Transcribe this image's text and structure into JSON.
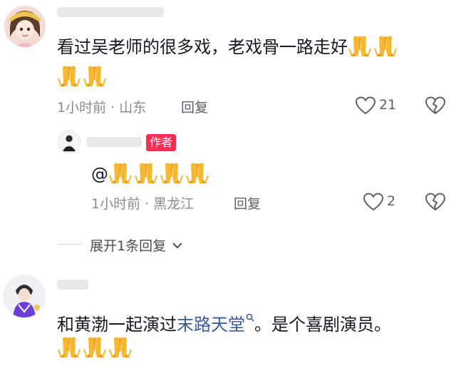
{
  "comments": [
    {
      "text": "看过吴老师的很多戏，老戏骨一路走好",
      "meta": "1小时前 · 山东",
      "reply_label": "回复",
      "likes": "21",
      "reply": {
        "badge": "作者",
        "text_prefix": "@",
        "meta": "1小时前 · 黑龙江",
        "reply_label": "回复",
        "likes": "2"
      },
      "expand_label": "展开1条回复"
    },
    {
      "text_before": "和黄渤一起演过",
      "link_text": "末路天堂",
      "text_after": "。是个喜剧演员。"
    }
  ],
  "colors": {
    "accent": "#fe2c55",
    "link": "#3c5b9b",
    "meta": "#8a8b91"
  },
  "icons": [
    "heart-icon",
    "broken-heart-icon",
    "search-icon",
    "chevron-down-icon",
    "prayer-hands-emoji"
  ]
}
